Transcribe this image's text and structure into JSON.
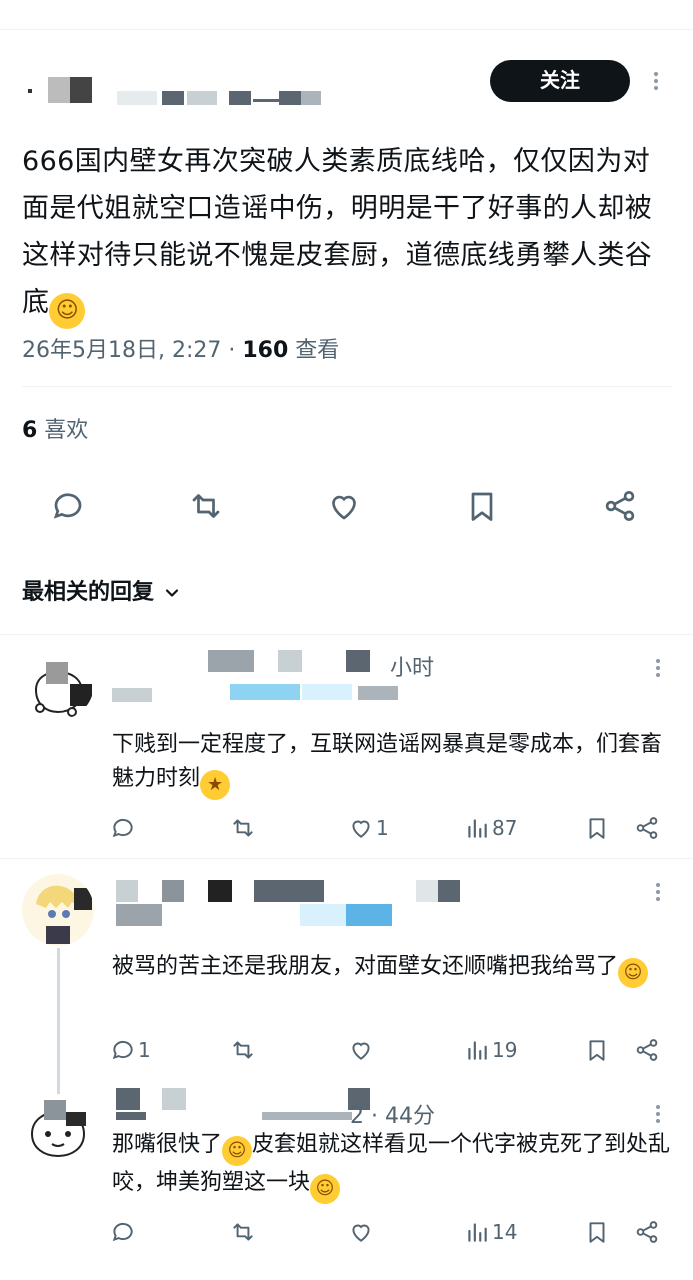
{
  "main_tweet": {
    "follow_label": "关注",
    "text": "666国内壁女再次突破人类素质底线哈，仅仅因为对面是代姐就空口造谣中伤，明明是干了好事的人却被这样对待只能说不愧是皮套厨，道德底线勇攀人类谷底",
    "text_emoji": "😂",
    "timestamp": "26年5月18日, 2:27 · ",
    "views_count": "160",
    "views_label": " 查看",
    "likes_count": "6",
    "likes_label": " 喜欢"
  },
  "sort": {
    "label": "最相关的回复"
  },
  "replies": [
    {
      "time": "小时",
      "text": "下贱到一定程度了，互联网造谣网暴真是零成本，们套畜魅力时刻",
      "text_emoji": "🤩",
      "reply_count": "",
      "like_count": "1",
      "view_count": "87"
    },
    {
      "time": "",
      "text": "被骂的苦主还是我朋友，对面壁女还顺嘴把我给骂了",
      "text_emoji": "😂",
      "reply_count": "1",
      "like_count": "",
      "view_count": "19"
    },
    {
      "time": "2 · 44分",
      "text_a": "那嘴很快了",
      "emoji_a": "😂",
      "text_b": "皮套姐就这样看见一个代字被克死了到处乱咬，坤美狗塑这一块",
      "emoji_b": "😂",
      "reply_count": "",
      "like_count": "",
      "view_count": "14"
    }
  ],
  "colors": {
    "text_primary": "#0f1419",
    "text_secondary": "#536471",
    "divider": "#eff3f4",
    "follow_bg": "#0f1419"
  },
  "icons": [
    "reply-icon",
    "retweet-icon",
    "heart-icon",
    "bookmark-icon",
    "share-icon",
    "views-icon",
    "chevron-down-icon",
    "more-icon"
  ]
}
